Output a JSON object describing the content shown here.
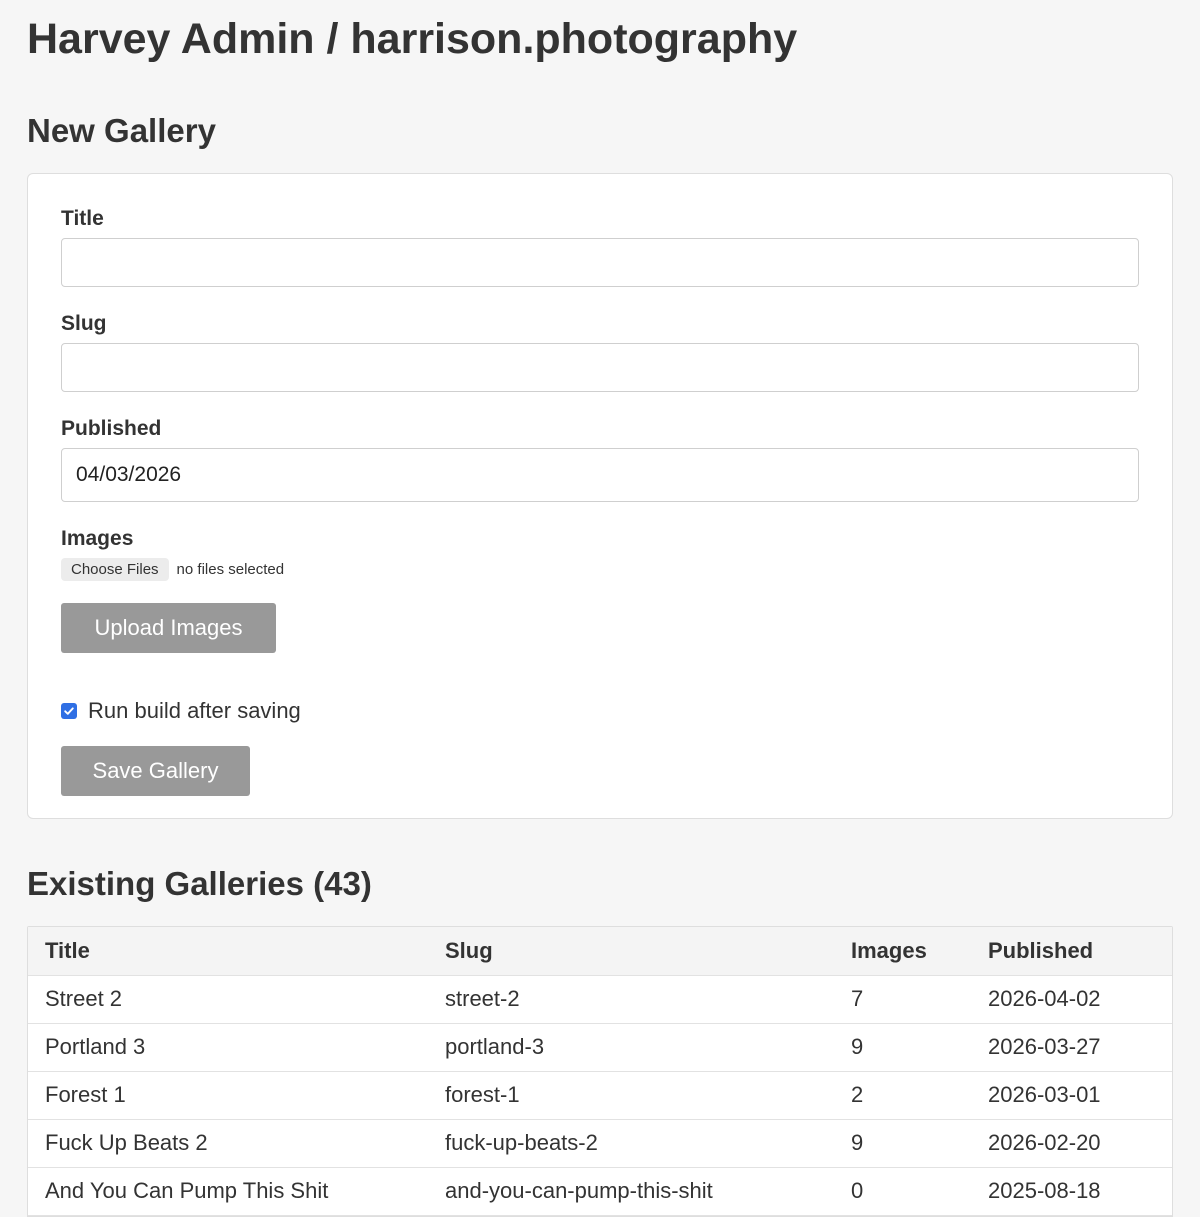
{
  "header": {
    "title": "Harvey Admin / harrison.photography"
  },
  "new_gallery": {
    "heading": "New Gallery",
    "title_label": "Title",
    "title_value": "",
    "slug_label": "Slug",
    "slug_value": "",
    "published_label": "Published",
    "published_value": "04/03/2026",
    "images_label": "Images",
    "choose_files_label": "Choose Files",
    "file_status": "no files selected",
    "upload_button": "Upload Images",
    "run_build_label": "Run build after saving",
    "run_build_checked": true,
    "save_button": "Save Gallery",
    "accent_color": "#2f6fe4",
    "button_color": "#999999"
  },
  "existing": {
    "heading": "Existing Galleries (43)",
    "columns": [
      "Title",
      "Slug",
      "Images",
      "Published"
    ],
    "rows": [
      {
        "title": "Street 2",
        "slug": "street-2",
        "images": "7",
        "published": "2026-04-02"
      },
      {
        "title": "Portland 3",
        "slug": "portland-3",
        "images": "9",
        "published": "2026-03-27"
      },
      {
        "title": "Forest 1",
        "slug": "forest-1",
        "images": "2",
        "published": "2026-03-01"
      },
      {
        "title": "Fuck Up Beats 2",
        "slug": "fuck-up-beats-2",
        "images": "9",
        "published": "2026-02-20"
      },
      {
        "title": "And You Can Pump This Shit",
        "slug": "and-you-can-pump-this-shit",
        "images": "0",
        "published": "2025-08-18"
      }
    ]
  }
}
